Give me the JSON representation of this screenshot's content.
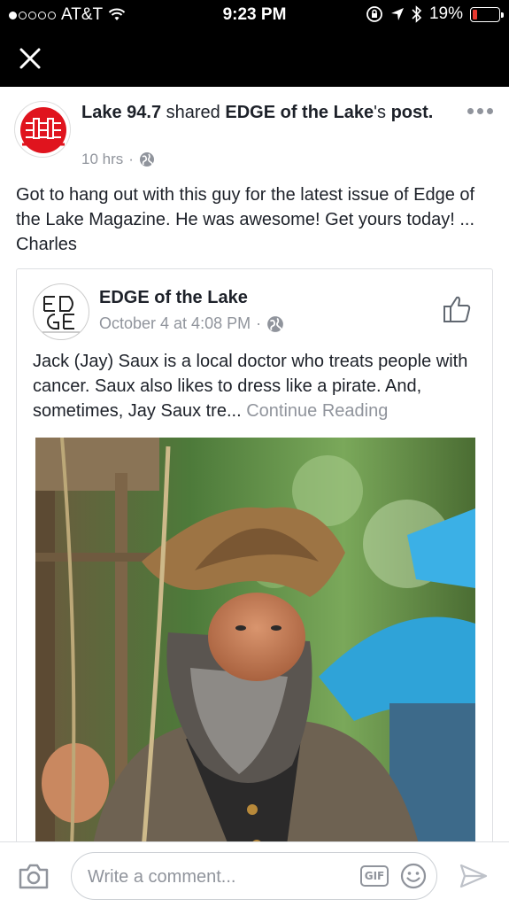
{
  "status_bar": {
    "carrier": "AT&T",
    "time": "9:23 PM",
    "battery": "19%",
    "battery_level": 0.19,
    "signal_bars": 1
  },
  "post": {
    "page_name": "Lake 94.7",
    "shared_word": "shared",
    "source_name": "EDGE of the Lake",
    "possessive": "'s",
    "post_word": "post.",
    "time": "10 hrs",
    "text": "Got to hang out with this guy for the latest issue of Edge of the Lake Magazine. He was awesome! Get yours today! ... Charles"
  },
  "shared": {
    "title": "EDGE of the Lake",
    "time": "October 4 at 4:08 PM",
    "text": "Jack (Jay) Saux is a local doctor who treats people with cancer. Saux also likes to dress like a pirate. And, sometimes, Jay Saux tre...",
    "continue_label": "Continue Reading"
  },
  "comment_bar": {
    "placeholder": "Write a comment...",
    "gif_label": "GIF"
  },
  "icons": {
    "close": "close-icon",
    "globe": "globe-icon",
    "like": "like-icon",
    "camera": "camera-icon",
    "emoji": "emoji-icon",
    "send": "send-icon",
    "more": "more-options-icon"
  },
  "colors": {
    "text_primary": "#1d2129",
    "text_secondary": "#90949c",
    "battery_low": "#e8382f",
    "brand_red": "#e0141e"
  }
}
